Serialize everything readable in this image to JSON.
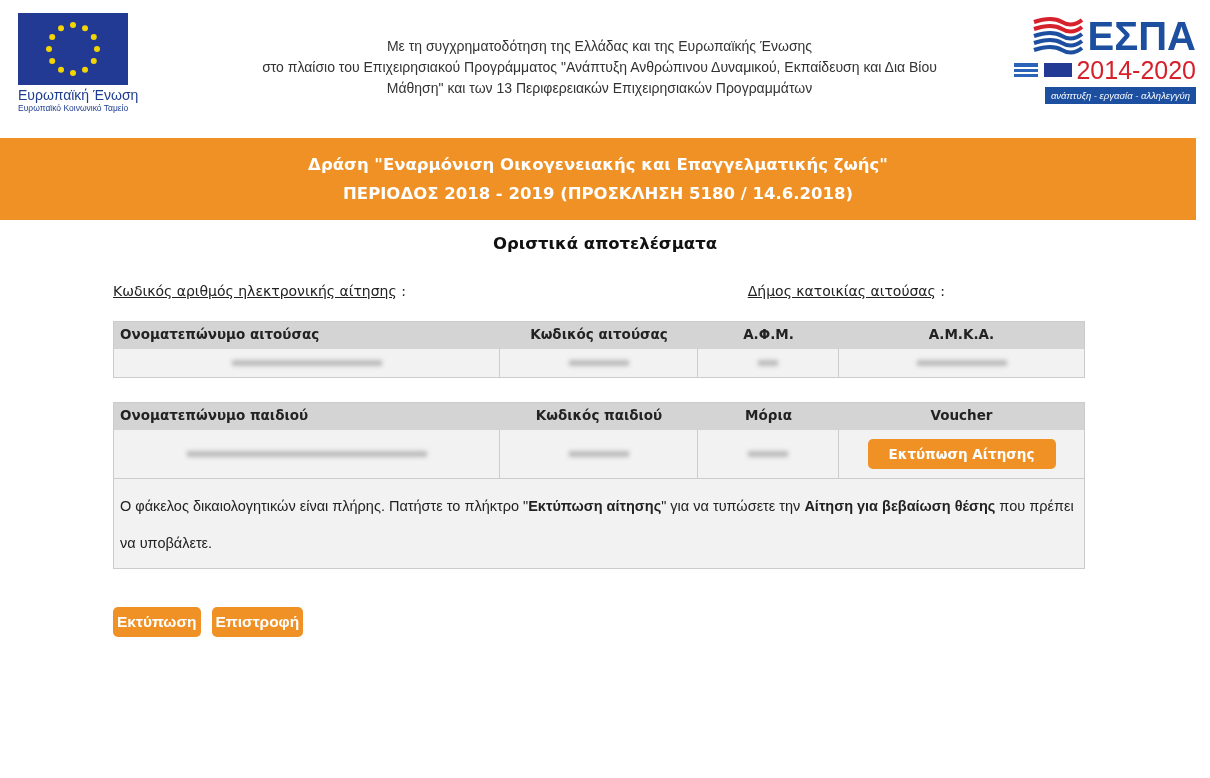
{
  "header": {
    "eu_logo": {
      "title": "Ευρωπαϊκή Ένωση",
      "subtitle": "Ευρωπαϊκό Κοινωνικό Ταμείο"
    },
    "funding_text": [
      "Με τη συγχρηματοδότηση της Ελλάδας και της Ευρωπαϊκής Ένωσης",
      "στο πλαίσιο του Επιχειρησιακού Προγράμματος \"Ανάπτυξη Ανθρώπινου Δυναμικού, Εκπαίδευση και Δια Βίου",
      "Μάθηση\" και των 13 Περιφερειακών Επιχειρησιακών Προγραμμάτων"
    ],
    "espa_logo": {
      "title": "ΕΣΠΑ",
      "years": "2014-2020",
      "motto": "ανάπτυξη - εργασία - αλληλεγγύη"
    }
  },
  "banner": {
    "title": "Δράση \"Εναρμόνιση Οικογενειακής και Επαγγελματικής ζωής\"",
    "subtitle": "ΠΕΡΙΟΔΟΣ 2018 - 2019 (ΠΡΟΣΚΛΗΣΗ 5180 / 14.6.2018)"
  },
  "page_title": "Οριστικά αποτελέσματα",
  "fields": [
    {
      "label": "Κωδικός αριθμός ηλεκτρονικής αίτησης",
      "separator": ":"
    },
    {
      "label": "Δήμος κατοικίας αιτούσας",
      "separator": ":"
    }
  ],
  "applicant_table": {
    "columns": [
      "Ονοματεπώνυμο αιτούσας",
      "Κωδικός αιτούσας",
      "Α.Φ.Μ.",
      "Α.Μ.Κ.Α."
    ]
  },
  "child_table": {
    "columns": [
      "Ονοματεπώνυμο παιδιού",
      "Κωδικός παιδιού",
      "Μόρια",
      "Voucher"
    ],
    "button": "Εκτύπωση Αίτησης",
    "note": "Ο φάκελος δικαιολογητικών είναι πλήρης. Πατήστε το πλήκτρο \"**Εκτύπωση αίτησης**\" για να τυπώσετε την **Αίτηση για βεβαίωση θέσης** που πρέπει να υποβάλετε."
  },
  "buttons": [
    "Εκτύπωση",
    "Επιστροφή"
  ]
}
